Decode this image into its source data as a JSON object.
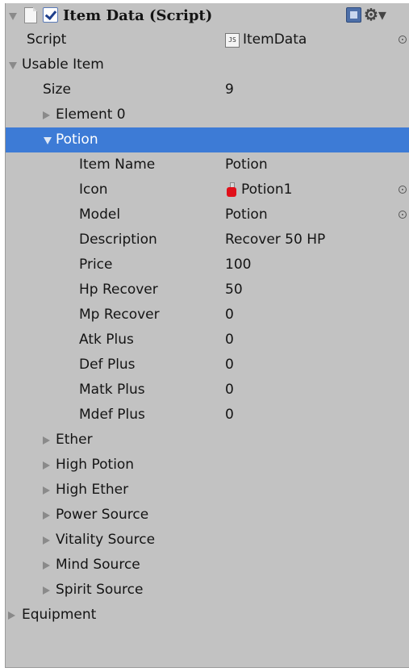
{
  "component": {
    "title": "Item Data (Script)",
    "enabled": true,
    "icons": [
      "doc-icon",
      "checkbox-icon",
      "help-icon",
      "gear-icon"
    ]
  },
  "script_field": {
    "label": "Script",
    "value": "ItemData",
    "icon": "js-icon",
    "icon_text": "JS"
  },
  "usable_item": {
    "label": "Usable Item",
    "size_label": "Size",
    "size_value": "9"
  },
  "element0": {
    "label": "Element 0"
  },
  "potion": {
    "label": "Potion",
    "fields": [
      {
        "label": "Item Name",
        "value": "Potion"
      },
      {
        "label": "Icon",
        "value": "Potion1"
      },
      {
        "label": "Model",
        "value": "Potion"
      },
      {
        "label": "Description",
        "value": "Recover 50 HP"
      },
      {
        "label": "Price",
        "value": "100"
      },
      {
        "label": "Hp Recover",
        "value": "50"
      },
      {
        "label": "Mp Recover",
        "value": "0"
      },
      {
        "label": "Atk Plus",
        "value": "0"
      },
      {
        "label": "Def Plus",
        "value": "0"
      },
      {
        "label": "Matk Plus",
        "value": "0"
      },
      {
        "label": "Mdef Plus",
        "value": "0"
      }
    ]
  },
  "collapsed_elements": [
    "Ether",
    "High Potion",
    "High Ether",
    "Power Source",
    "Vitality Source",
    "Mind Source",
    "Spirit Source"
  ],
  "equipment": {
    "label": "Equipment"
  },
  "colors": {
    "panel_bg": "#c2c2c2",
    "selection": "#3d7bd6",
    "text": "#141414"
  }
}
